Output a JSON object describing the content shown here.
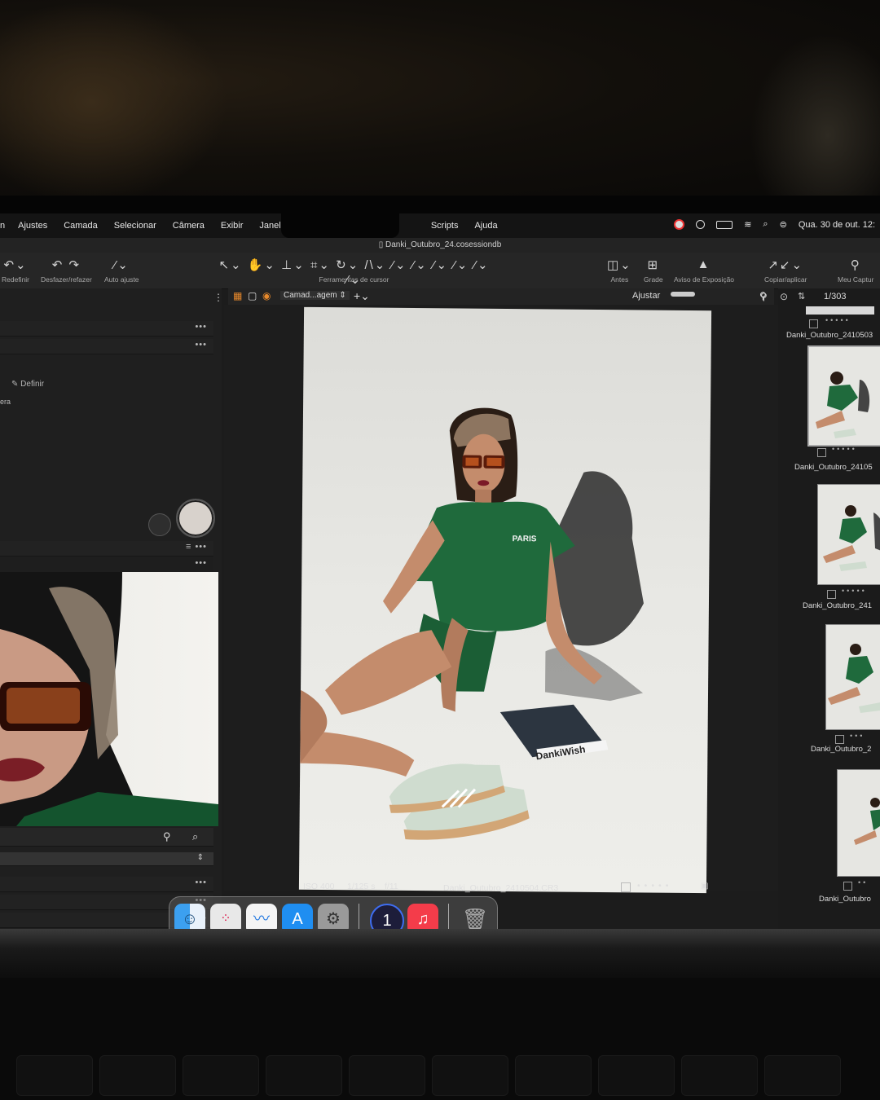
{
  "menu": {
    "items": [
      "Ajustes",
      "Camada",
      "Selecionar",
      "Câmera",
      "Exibir",
      "Janela",
      "Scripts",
      "Ajuda"
    ],
    "clock": "Qua. 30 de out. 12:"
  },
  "window": {
    "title": "Danki_Outubro_24.cosessiondb"
  },
  "toolbar": {
    "redefinir": "Redefinir",
    "undo_redo": "Desfazer/refazer",
    "auto_ajuste": "Auto ajuste",
    "cursor_tools": "Ferramentas de cursor",
    "antes": "Antes",
    "grade": "Grade",
    "aviso": "Aviso de Exposição",
    "copiar": "Copiar/aplicar",
    "meu_capture": "Meu Captur"
  },
  "left_panel": {
    "definir": "Definir",
    "partial": "era"
  },
  "viewer": {
    "layer_select": "Camad...agem",
    "ajustar": "Ajustar",
    "counter": "1/303",
    "iso": "ISO 400",
    "shutter": "1/125 s",
    "aperture": "f/11",
    "filename": "Danki_Outubro_2410504.CR3",
    "shirt_text": "PARIS",
    "magazine_text": "DankiWish"
  },
  "filmstrip": {
    "items": [
      {
        "label": "Danki_Outubro_2410503"
      },
      {
        "label": "Danki_Outubro_24105"
      },
      {
        "label": "Danki_Outubro_241"
      },
      {
        "label": "Danki_Outubro_2"
      },
      {
        "label": "Danki_Outubro"
      }
    ]
  },
  "dock": {
    "apps": [
      "finder-icon",
      "launchpad-icon",
      "freeform-icon",
      "app-store-icon",
      "settings-icon",
      "1password-icon",
      "music-icon",
      "trash-icon"
    ]
  },
  "colors": {
    "accent_green": "#1f6a3c",
    "backdrop": "#e8e8e4",
    "app_bg": "#1c1c1c"
  }
}
